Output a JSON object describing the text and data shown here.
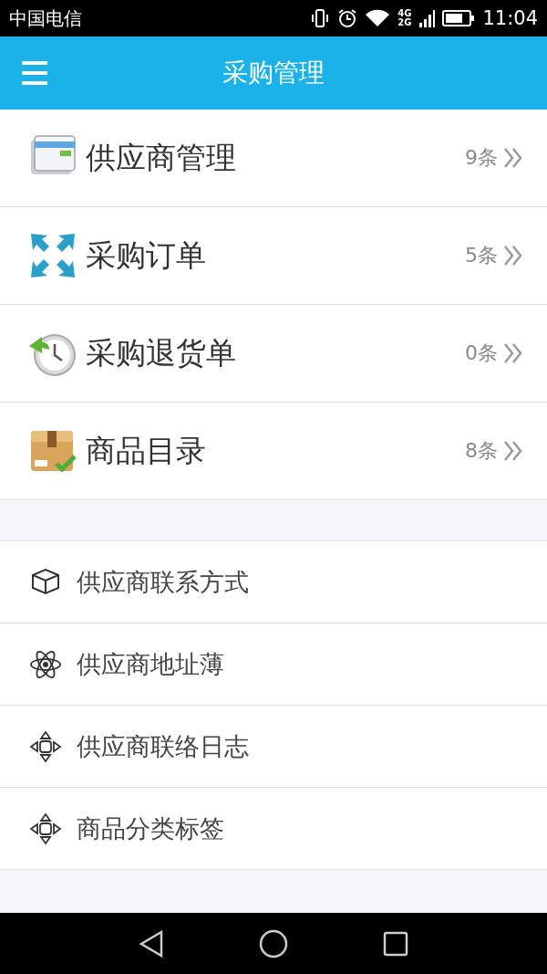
{
  "status_bar": {
    "carrier": "中国电信",
    "network_top": "4G",
    "network_bottom": "2G",
    "time": "11:04"
  },
  "app_bar": {
    "title": "采购管理"
  },
  "main_items": [
    {
      "label": "供应商管理",
      "count": "9条"
    },
    {
      "label": "采购订单",
      "count": "5条"
    },
    {
      "label": "采购退货单",
      "count": "0条"
    },
    {
      "label": "商品目录",
      "count": "8条"
    }
  ],
  "sub_items": [
    {
      "label": "供应商联系方式"
    },
    {
      "label": "供应商地址薄"
    },
    {
      "label": "供应商联络日志"
    },
    {
      "label": "商品分类标签"
    }
  ]
}
